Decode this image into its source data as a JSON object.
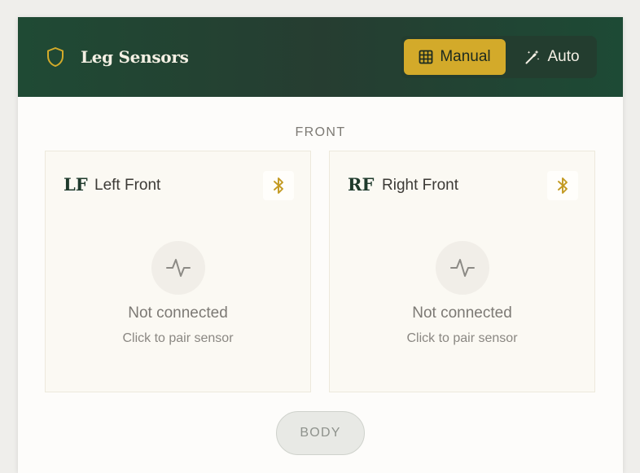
{
  "header": {
    "title": "Leg Sensors",
    "brand_icon": "shield-icon",
    "modes": {
      "manual": {
        "label": "Manual",
        "icon": "grid-icon",
        "active": true
      },
      "auto": {
        "label": "Auto",
        "icon": "magic-wand-icon",
        "active": false
      }
    }
  },
  "colors": {
    "header_bg": "#1f4a34",
    "accent": "#d3aa2a",
    "card_bg": "#fbf9f3"
  },
  "section": {
    "label": "FRONT"
  },
  "sensors": [
    {
      "code": "LF",
      "name": "Left Front",
      "status": "Not connected",
      "hint": "Click to pair sensor",
      "icon": "bluetooth-icon"
    },
    {
      "code": "RF",
      "name": "Right Front",
      "status": "Not connected",
      "hint": "Click to pair sensor",
      "icon": "bluetooth-icon"
    }
  ],
  "body_button": {
    "label": "BODY"
  }
}
